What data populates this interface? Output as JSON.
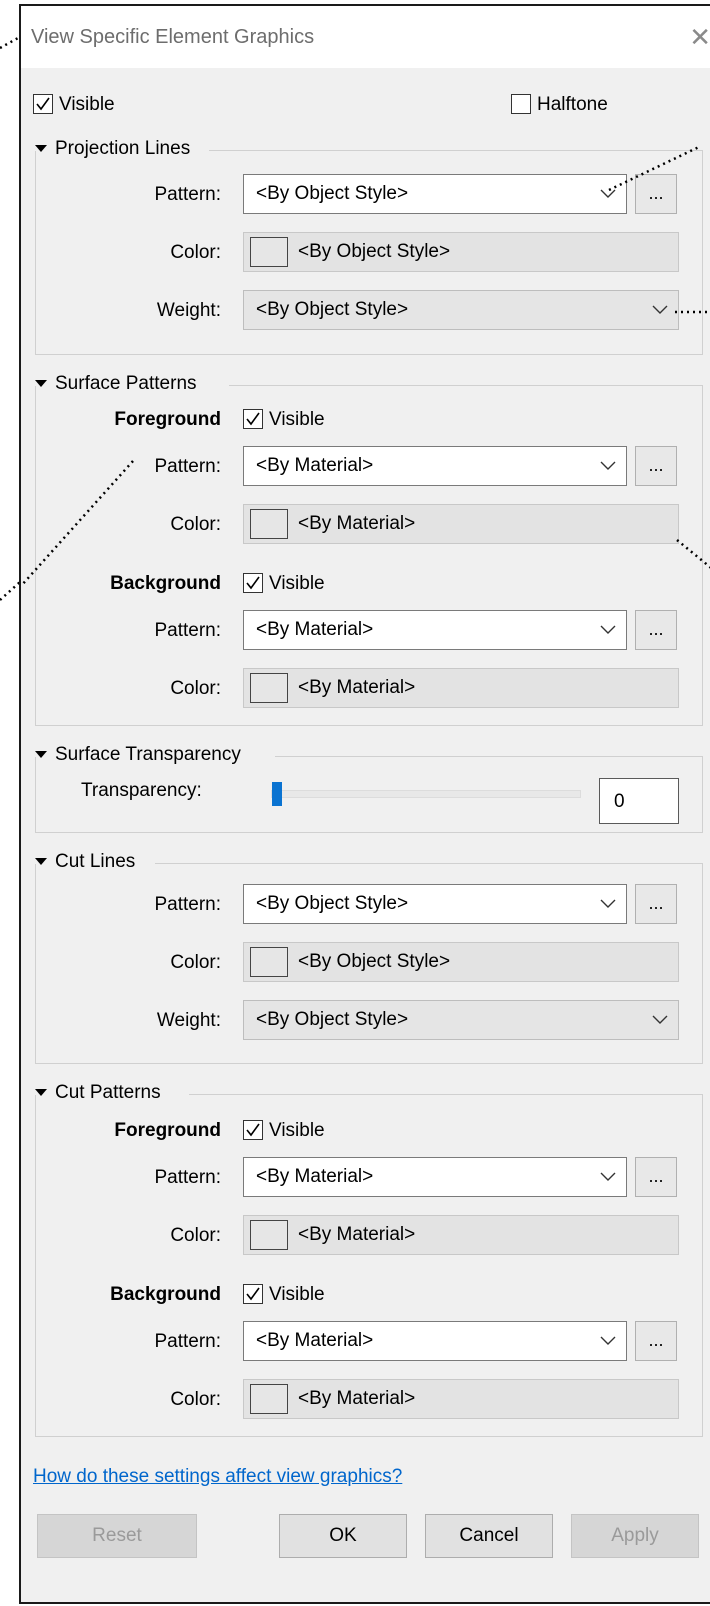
{
  "window": {
    "title": "View Specific Element Graphics",
    "close_glyph": "✕"
  },
  "top": {
    "visible_label": "Visible",
    "visible_checked": true,
    "halftone_label": "Halftone",
    "halftone_checked": false
  },
  "projection_lines": {
    "header": "Projection Lines",
    "pattern_label": "Pattern:",
    "pattern_value": "<By Object Style>",
    "color_label": "Color:",
    "color_value": "<By Object Style>",
    "weight_label": "Weight:",
    "weight_value": "<By Object Style>"
  },
  "surface_patterns": {
    "header": "Surface Patterns",
    "foreground_label": "Foreground",
    "foreground_visible_label": "Visible",
    "foreground_visible": true,
    "fg_pattern_label": "Pattern:",
    "fg_pattern_value": "<By Material>",
    "fg_color_label": "Color:",
    "fg_color_value": "<By Material>",
    "background_label": "Background",
    "background_visible_label": "Visible",
    "background_visible": true,
    "bg_pattern_label": "Pattern:",
    "bg_pattern_value": "<By Material>",
    "bg_color_label": "Color:",
    "bg_color_value": "<By Material>"
  },
  "surface_transparency": {
    "header": "Surface Transparency",
    "transparency_label": "Transparency:",
    "transparency_value": "0"
  },
  "cut_lines": {
    "header": "Cut Lines",
    "pattern_label": "Pattern:",
    "pattern_value": "<By Object Style>",
    "color_label": "Color:",
    "color_value": "<By Object Style>",
    "weight_label": "Weight:",
    "weight_value": "<By Object Style>"
  },
  "cut_patterns": {
    "header": "Cut Patterns",
    "foreground_label": "Foreground",
    "foreground_visible_label": "Visible",
    "foreground_visible": true,
    "fg_pattern_label": "Pattern:",
    "fg_pattern_value": "<By Material>",
    "fg_color_label": "Color:",
    "fg_color_value": "<By Material>",
    "background_label": "Background",
    "background_visible_label": "Visible",
    "background_visible": true,
    "bg_pattern_label": "Pattern:",
    "bg_pattern_value": "<By Material>",
    "bg_color_label": "Color:",
    "bg_color_value": "<By Material>"
  },
  "ellipsis_glyph": "...",
  "help_link": "How do these settings affect view graphics?",
  "buttons": {
    "reset": "Reset",
    "ok": "OK",
    "cancel": "Cancel",
    "apply": "Apply"
  },
  "colors": {
    "accent": "#0a73d1",
    "link": "#0066cc",
    "dialog_bg": "#f0f0f0"
  }
}
